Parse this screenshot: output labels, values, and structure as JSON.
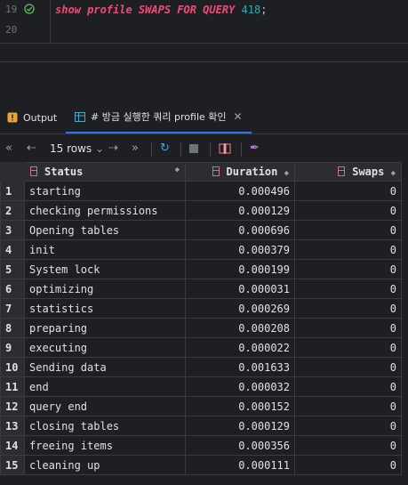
{
  "editor": {
    "line_numbers": [
      "19",
      "20"
    ],
    "code": {
      "keywords1": "show profile SWAPS FOR QUERY",
      "number": "418",
      "semicolon": ";"
    }
  },
  "tabs": [
    {
      "label": "Output",
      "icon": "output-warning-icon"
    },
    {
      "label": "# 방금 실행한 쿼리 profile 확인",
      "icon": "table-icon",
      "active": true
    }
  ],
  "toolbar": {
    "rows_label": "15 rows"
  },
  "table": {
    "columns": [
      "Status",
      "Duration",
      "Swaps"
    ],
    "rows": [
      [
        "1",
        "starting",
        "0.000496",
        "0"
      ],
      [
        "2",
        "checking permissions",
        "0.000129",
        "0"
      ],
      [
        "3",
        "Opening tables",
        "0.000696",
        "0"
      ],
      [
        "4",
        "init",
        "0.000379",
        "0"
      ],
      [
        "5",
        "System lock",
        "0.000199",
        "0"
      ],
      [
        "6",
        "optimizing",
        "0.000031",
        "0"
      ],
      [
        "7",
        "statistics",
        "0.000269",
        "0"
      ],
      [
        "8",
        "preparing",
        "0.000208",
        "0"
      ],
      [
        "9",
        "executing",
        "0.000022",
        "0"
      ],
      [
        "10",
        "Sending data",
        "0.001633",
        "0"
      ],
      [
        "11",
        "end",
        "0.000032",
        "0"
      ],
      [
        "12",
        "query end",
        "0.000152",
        "0"
      ],
      [
        "13",
        "closing tables",
        "0.000129",
        "0"
      ],
      [
        "14",
        "freeing items",
        "0.000356",
        "0"
      ],
      [
        "15",
        "cleaning up",
        "0.000111",
        "0"
      ]
    ]
  },
  "colors": {
    "background": "#1e1f22",
    "keyword": "#ee4b7a",
    "number": "#2aacb8",
    "accent": "#3574f0"
  }
}
